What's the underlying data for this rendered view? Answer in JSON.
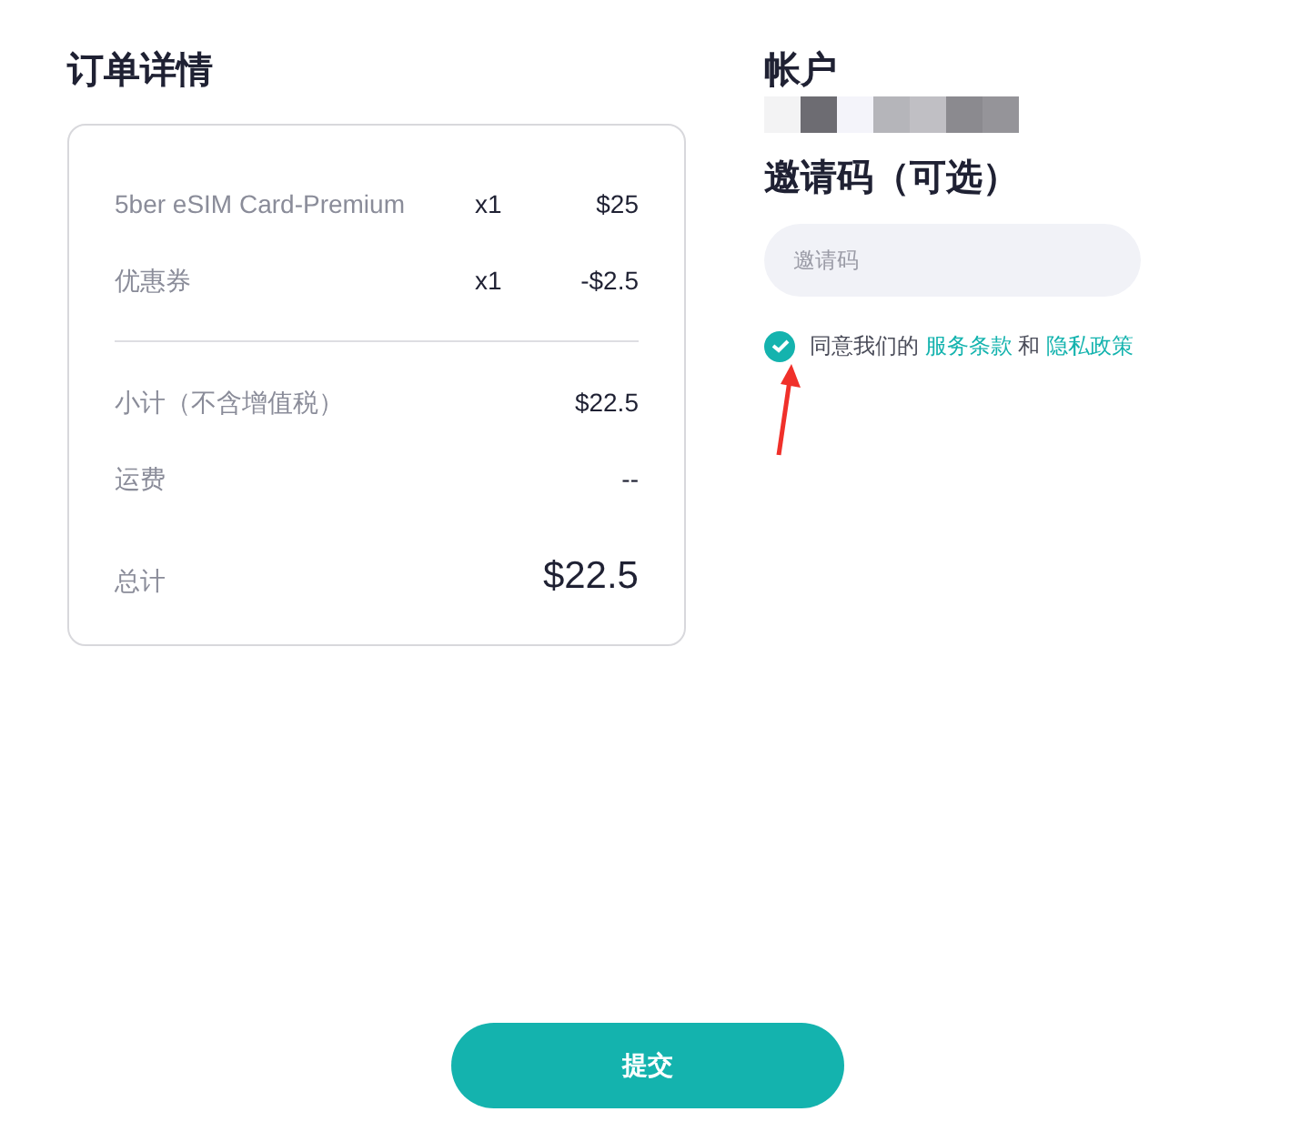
{
  "order": {
    "title": "订单详情",
    "rows": [
      {
        "kind": "item",
        "label": "5ber eSIM Card-Premium",
        "qty": "x1",
        "amount": "$25"
      },
      {
        "kind": "item",
        "label": "优惠券",
        "qty": "x1",
        "amount": "-$2.5"
      },
      {
        "kind": "divider"
      },
      {
        "kind": "summary",
        "label": "小计（不含增值税）",
        "amount": "$22.5"
      },
      {
        "kind": "summary",
        "label": "运费",
        "amount": "--"
      },
      {
        "kind": "total",
        "label": "总计",
        "amount": "$22.5"
      }
    ]
  },
  "account": {
    "title": "帐户"
  },
  "invite": {
    "title": "邀请码（可选）",
    "placeholder": "邀请码"
  },
  "agreement": {
    "checked": true,
    "text": "同意我们的",
    "terms_link": "服务条款",
    "connector": "和",
    "privacy_link": "隐私政策"
  },
  "submit": "提交"
}
